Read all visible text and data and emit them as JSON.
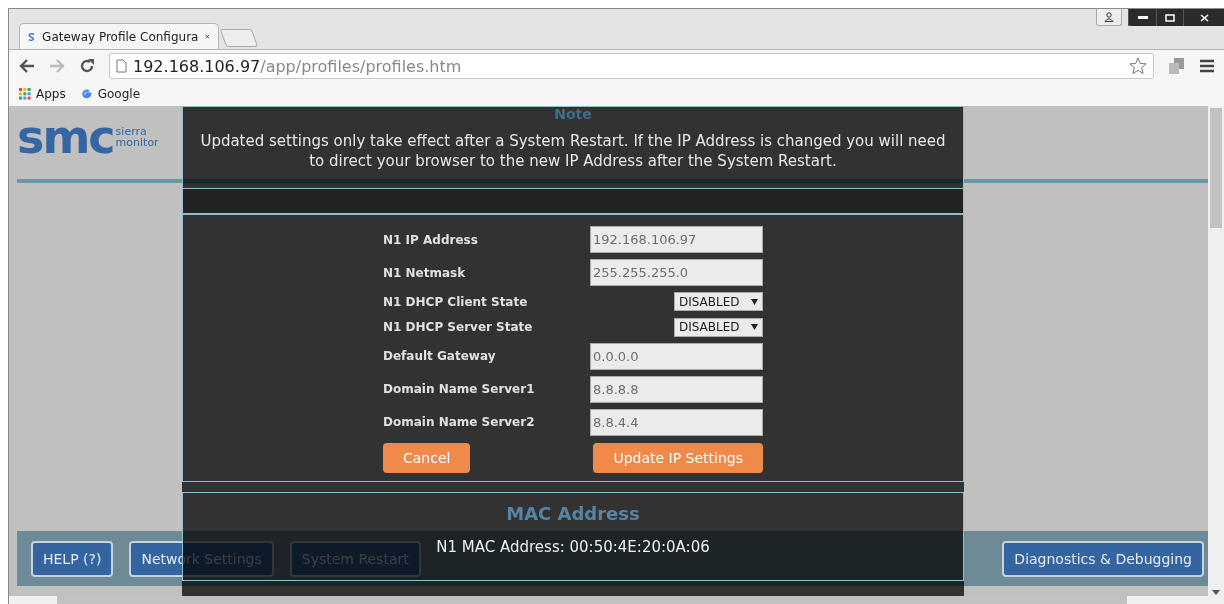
{
  "browser": {
    "tabs": [
      {
        "title": "Gateway Profile Configura",
        "selected": true
      }
    ],
    "url_host": "192.168.106.97",
    "url_path": "/app/profiles/profiles.htm",
    "bookmarks": [
      {
        "label": "Apps",
        "kind": "apps"
      },
      {
        "label": "Google",
        "kind": "google"
      }
    ]
  },
  "page": {
    "logo": {
      "mark": "smc",
      "tagline_1": "sierra",
      "tagline_2": "monitor"
    },
    "nav_left": [
      {
        "label": "HELP (?)"
      },
      {
        "label": "Network Settings"
      },
      {
        "label": "System Restart"
      }
    ],
    "nav_right": [
      {
        "label": "Diagnostics & Debugging"
      }
    ]
  },
  "dialog": {
    "title": "Note",
    "message": "Updated settings only take effect after a System Restart. If the IP Address is changed you will need to direct your browser to the new IP Address after the System Restart.",
    "fields": [
      {
        "label": "N1 IP Address",
        "kind": "text",
        "value": "192.168.106.97"
      },
      {
        "label": "N1 Netmask",
        "kind": "text",
        "value": "255.255.255.0"
      },
      {
        "label": "N1 DHCP Client State",
        "kind": "select",
        "value": "DISABLED"
      },
      {
        "label": "N1 DHCP Server State",
        "kind": "select",
        "value": "DISABLED"
      },
      {
        "label": "Default Gateway",
        "kind": "text",
        "value": "0.0.0.0"
      },
      {
        "label": "Domain Name Server1",
        "kind": "text",
        "value": "8.8.8.8"
      },
      {
        "label": "Domain Name Server2",
        "kind": "text",
        "value": "8.8.4.4"
      }
    ],
    "buttons": [
      {
        "label": "Cancel"
      },
      {
        "label": "Update IP Settings"
      }
    ],
    "mac_section": {
      "title": "MAC Address",
      "text": "N1 MAC Address: 00:50:4E:20:0A:06"
    }
  }
}
